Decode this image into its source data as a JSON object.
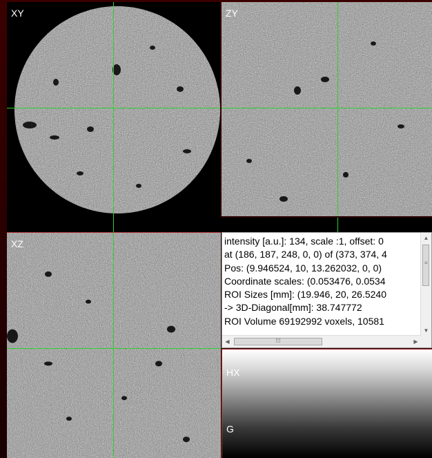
{
  "panes": {
    "xy_label": "XY",
    "zy_label": "ZY",
    "xz_label": "XZ"
  },
  "info": {
    "lines": [
      "intensity [a.u.]: 134, scale :1, offset: 0",
      "at (186, 187, 248, 0, 0) of (373, 374, 4",
      "Pos: (9.946524, 10, 13.262032, 0, 0)",
      "Coordinate scales: (0.053476, 0.0534",
      "ROI Sizes [mm]: (19.946, 20, 26.5240",
      " -> 3D-Diagonal[mm]: 38.747772",
      "ROI Volume 69192992 voxels, 10581"
    ],
    "scroll_icons": {
      "up": "arrow-up-icon",
      "down": "arrow-down-icon",
      "left": "arrow-left-icon",
      "right": "arrow-right-icon"
    }
  },
  "histogram": {
    "label_top": "HX",
    "label_bottom": "G"
  },
  "colors": {
    "crosshair": "#2fd02f",
    "border_accent": "#b03030",
    "background": "#200000"
  }
}
